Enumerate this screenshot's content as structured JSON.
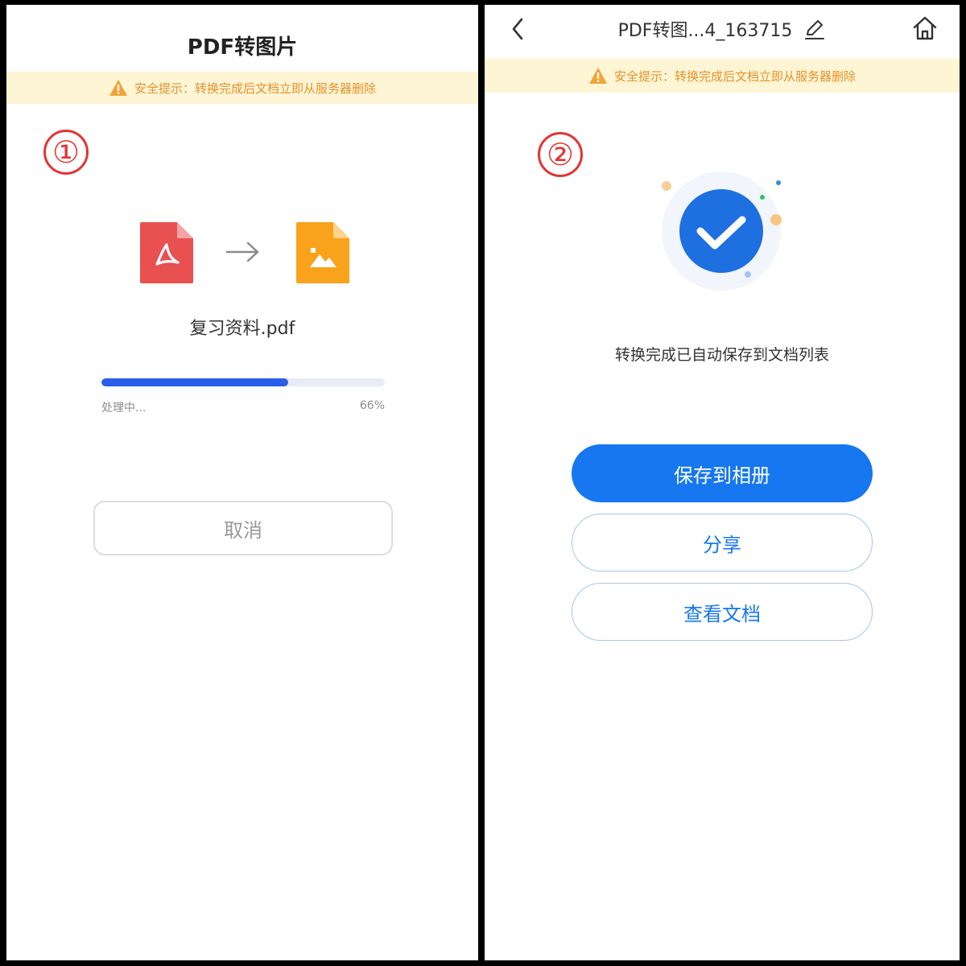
{
  "left_panel": {
    "title": "PDF转图片",
    "banner_text": "安全提示：转换完成后文档立即从服务器删除",
    "step_number": "①",
    "icons": {
      "source": "pdf-file-icon",
      "arrow": "arrow-right-icon",
      "target": "image-file-icon"
    },
    "filename": "复习资料.pdf",
    "progress": {
      "status": "处理中...",
      "percent_label": "66%",
      "value": 0.66
    },
    "cancel_label": "取消"
  },
  "right_panel": {
    "title": "PDF转图...4_163715",
    "icons": {
      "back": "chevron-left-icon",
      "edit": "pencil-icon",
      "home": "home-icon",
      "success": "check-circle-icon"
    },
    "banner_text": "安全提示：转换完成后文档立即从服务器删除",
    "step_number": "②",
    "success_text": "转换完成已自动保存到文档列表",
    "buttons": {
      "save": "保存到相册",
      "share": "分享",
      "view": "查看文档"
    }
  },
  "colors": {
    "accent_blue": "#1677f0",
    "progress_blue": "#2a5ee8",
    "warning_orange": "#e8912c",
    "banner_bg": "#fdf5d4",
    "pdf_red": "#e95050",
    "image_orange": "#f9a21b",
    "step_red": "#e53333"
  }
}
